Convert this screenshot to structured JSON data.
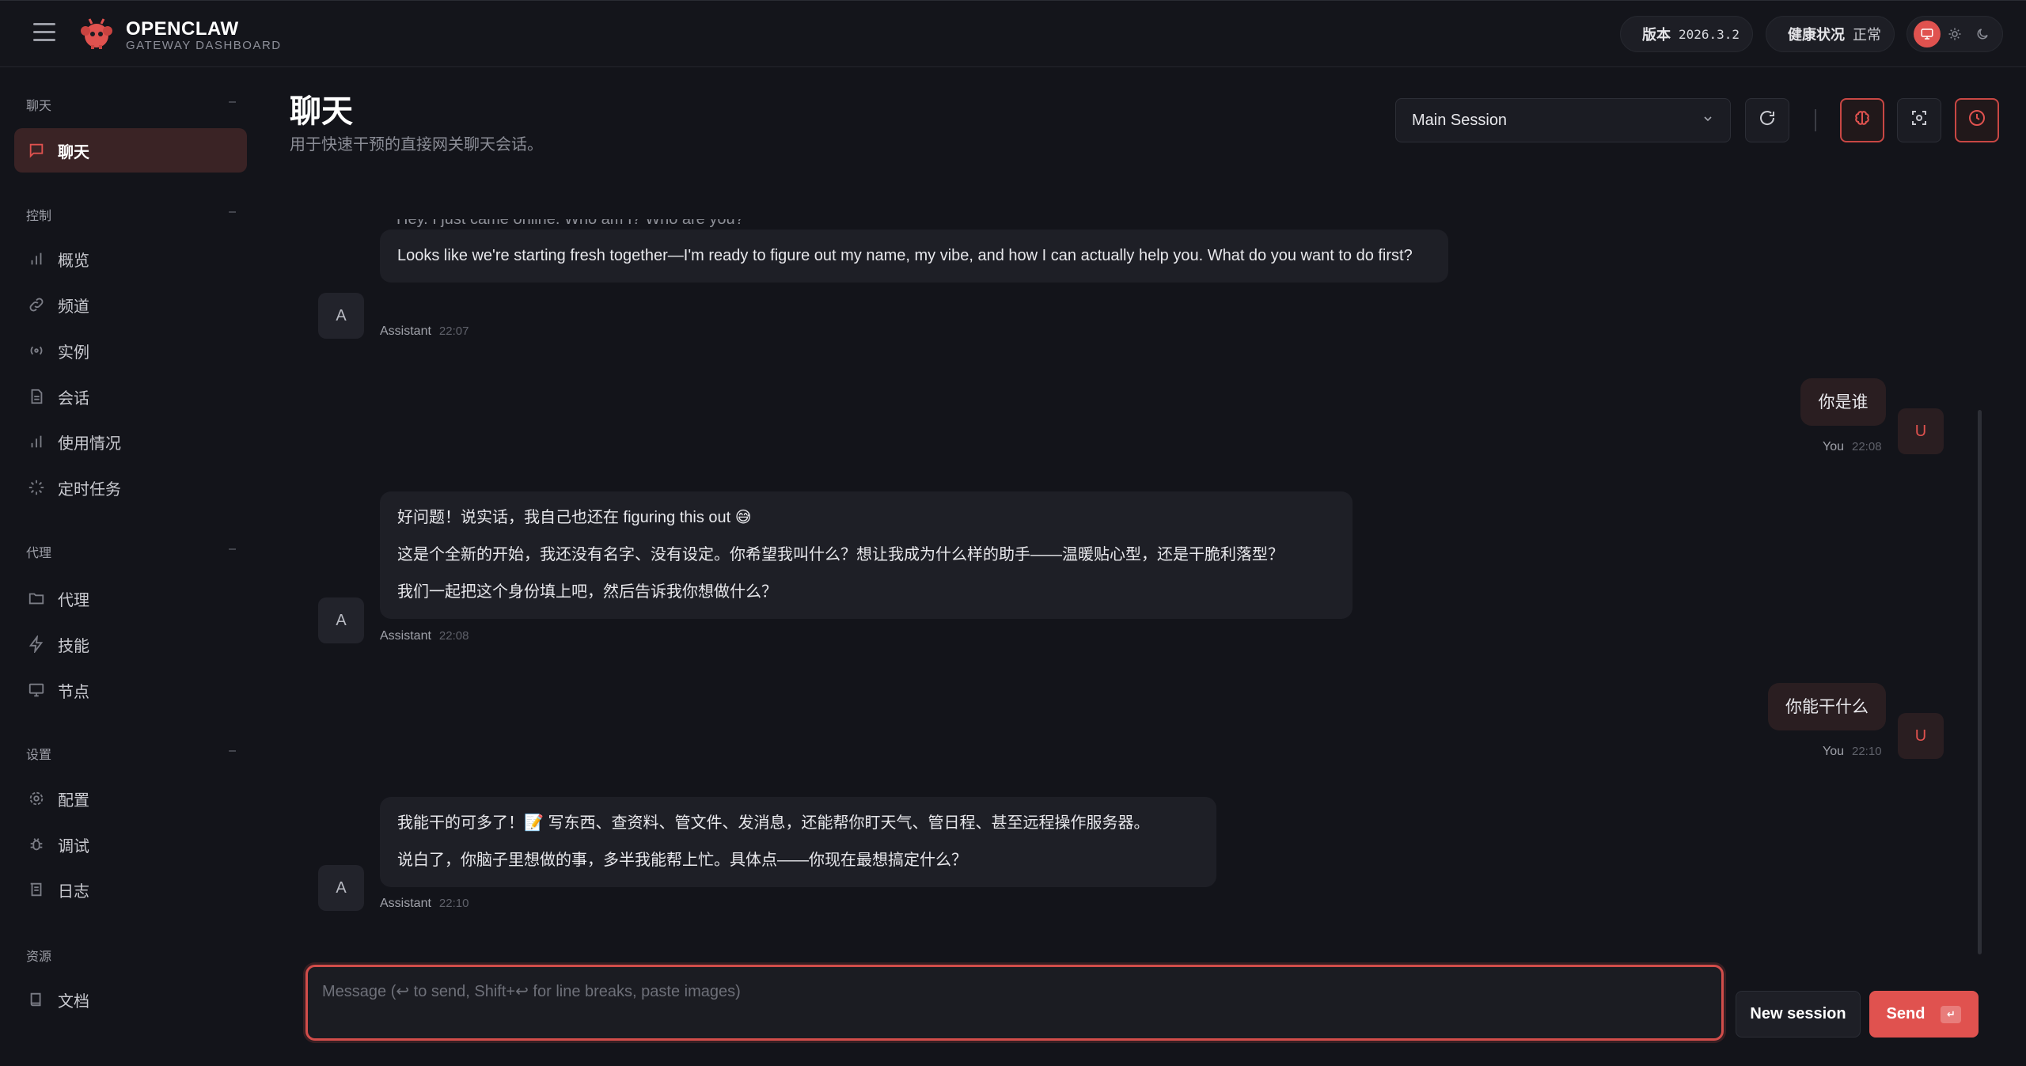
{
  "app": {
    "title": "OPENCLAW",
    "subtitle": "GATEWAY DASHBOARD"
  },
  "status": {
    "version_label": "版本",
    "version_value": "2026.3.2",
    "health_label": "健康状况",
    "health_value": "正常",
    "status_color": "#3ddc84"
  },
  "colors": {
    "accent": "#e0524f",
    "background": "#13141a",
    "bubble": "#1e1f26"
  },
  "sidebar": {
    "sections": [
      {
        "title": "聊天",
        "items": [
          {
            "label": "聊天",
            "icon": "message-icon",
            "active": true
          }
        ]
      },
      {
        "title": "控制",
        "items": [
          {
            "label": "概览",
            "icon": "bar-chart-icon"
          },
          {
            "label": "频道",
            "icon": "link-icon"
          },
          {
            "label": "实例",
            "icon": "radio-icon"
          },
          {
            "label": "会话",
            "icon": "file-icon"
          },
          {
            "label": "使用情况",
            "icon": "bar-chart-icon"
          },
          {
            "label": "定时任务",
            "icon": "loader-icon"
          }
        ]
      },
      {
        "title": "代理",
        "items": [
          {
            "label": "代理",
            "icon": "folder-icon"
          },
          {
            "label": "技能",
            "icon": "zap-icon"
          },
          {
            "label": "节点",
            "icon": "monitor-icon"
          }
        ]
      },
      {
        "title": "设置",
        "items": [
          {
            "label": "配置",
            "icon": "gear-icon"
          },
          {
            "label": "调试",
            "icon": "bug-icon"
          },
          {
            "label": "日志",
            "icon": "scroll-icon"
          }
        ]
      },
      {
        "title": "资源",
        "items": [
          {
            "label": "文档",
            "icon": "book-icon"
          }
        ]
      }
    ]
  },
  "header": {
    "title": "聊天",
    "subtitle": "用于快速干预的直接网关聊天会话。",
    "session": "Main Session"
  },
  "chat": {
    "partial_top": "Hey. I just came online. Who am I? Who are you?",
    "messages": [
      {
        "role": "assistant",
        "avatar": "A",
        "paragraphs": [
          "Looks like we're starting fresh together—I'm ready to figure out my name, my vibe, and how I can actually help you. What do you want to do first?"
        ],
        "sender": "Assistant",
        "time": "22:07"
      },
      {
        "role": "user",
        "avatar": "U",
        "text": "你是谁",
        "sender": "You",
        "time": "22:08"
      },
      {
        "role": "assistant",
        "avatar": "A",
        "paragraphs": [
          "好问题！说实话，我自己也还在 figuring this out 😅",
          "这是个全新的开始，我还没有名字、没有设定。你希望我叫什么？想让我成为什么样的助手——温暖贴心型，还是干脆利落型？",
          "我们一起把这个身份填上吧，然后告诉我你想做什么？"
        ],
        "sender": "Assistant",
        "time": "22:08"
      },
      {
        "role": "user",
        "avatar": "U",
        "text": "你能干什么",
        "sender": "You",
        "time": "22:10"
      },
      {
        "role": "assistant",
        "avatar": "A",
        "paragraphs": [
          "我能干的可多了！📝 写东西、查资料、管文件、发消息，还能帮你盯天气、管日程、甚至远程操作服务器。",
          "说白了，你脑子里想做的事，多半我能帮上忙。具体点——你现在最想搞定什么？"
        ],
        "sender": "Assistant",
        "time": "22:10"
      }
    ]
  },
  "composer": {
    "placeholder": "Message (↩ to send, Shift+↩ for line breaks, paste images)",
    "value": "",
    "new_session_label": "New session",
    "send_label": "Send",
    "send_key": "↵"
  }
}
